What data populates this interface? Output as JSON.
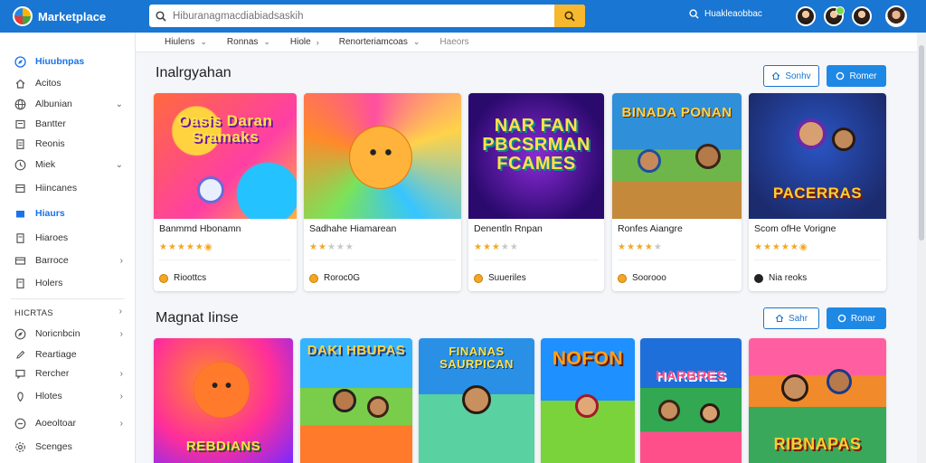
{
  "app": {
    "brand": "Marketplace",
    "logo_icon": "globe-logo-icon"
  },
  "search": {
    "placeholder": "Hiburanagmacdiabiadsaskih",
    "value": ""
  },
  "top_link": {
    "label": "Huakleaobbac",
    "icon": "search-icon"
  },
  "sidebar": {
    "items": [
      {
        "label": "Hiuubnpas",
        "icon": "compass-icon",
        "active": true
      },
      {
        "label": "Acitos",
        "icon": "home-icon"
      },
      {
        "label": "Albunian",
        "icon": "globe-icon",
        "chevron": "down"
      },
      {
        "label": "Bantter",
        "icon": "edit-icon"
      },
      {
        "label": "Reonis",
        "icon": "doc-icon"
      },
      {
        "label": "Miek",
        "icon": "clock-icon",
        "chevron": "down"
      },
      {
        "label": "Hiincanes",
        "icon": "list-icon"
      },
      {
        "label": "Hiaurs",
        "icon": "folder-icon",
        "active": true
      },
      {
        "label": "Hiaroes",
        "icon": "doc-icon"
      },
      {
        "label": "Barroce",
        "icon": "card-icon",
        "chevron": "right"
      },
      {
        "label": "Holers",
        "icon": "doc-icon"
      }
    ],
    "heading": "HICRTAS",
    "heading_chevron": "right",
    "sub_items": [
      {
        "label": "Noricnbcin",
        "icon": "compass-icon",
        "chevron": "right"
      },
      {
        "label": "Reartiage",
        "icon": "edit-icon"
      },
      {
        "label": "Rercher",
        "icon": "chat-icon",
        "chevron": "right"
      },
      {
        "label": "Hlotes",
        "icon": "pin-icon",
        "chevron": "right"
      },
      {
        "label": "Aoeoltoar",
        "icon": "clock-icon",
        "chevron": "right"
      },
      {
        "label": "Scenges",
        "icon": "gear-icon"
      }
    ]
  },
  "subnav": {
    "items": [
      {
        "label": "Hiulens",
        "chevron": "down"
      },
      {
        "label": "Ronnas",
        "chevron": "down"
      },
      {
        "label": "Hiole",
        "chevron": "right"
      },
      {
        "label": "Renorteriamcoas",
        "chevron": "down"
      },
      {
        "label": "Haeors",
        "muted": true
      }
    ]
  },
  "section1": {
    "title": "Inalrgyahan",
    "outline_button": "Sonhv",
    "solid_button": "Romer",
    "cards": [
      {
        "thumb_title": "Oasis Daran Sramaks",
        "name": "Banmmd Hbonamn",
        "rating": 5,
        "badge": true,
        "price": "Rioottcs",
        "colors": [
          "#ff6a3d",
          "#ffd23f",
          "#ff3fa4"
        ]
      },
      {
        "thumb_title": "",
        "name": "Sadhahe Hiamarean",
        "rating": 2,
        "badge": true,
        "price": "Roroc0G",
        "colors": [
          "#ff4fa0",
          "#ffd24a",
          "#36c5ff"
        ]
      },
      {
        "thumb_title": "NAR FAN PBCSRMAN FCAMES",
        "name": "Denentln Rnpan",
        "rating": 3,
        "badge": false,
        "price": "Suueriles",
        "colors": [
          "#5b1aa8",
          "#2b0a6e",
          "#8b2ad6"
        ]
      },
      {
        "thumb_title": "BINADA PONAN",
        "name": "Ronfes Aiangre",
        "rating": 4,
        "badge": false,
        "price": "Soorooo",
        "colors": [
          "#2f8fd8",
          "#6fb64a",
          "#e0a040"
        ]
      },
      {
        "thumb_title": "PACERRAS",
        "name": "Scom ofHe Vorigne",
        "rating": 5,
        "badge": true,
        "price": "Nia reoks",
        "colors": [
          "#1c2b6e",
          "#2a55c4",
          "#d04aa8"
        ]
      }
    ]
  },
  "section2": {
    "title": "Magnat Iinse",
    "outline_button": "Sahr",
    "solid_button": "Ronar",
    "cards": [
      {
        "thumb_title": "REBDIANS",
        "colors": [
          "#ff2e9a",
          "#ff8a2a",
          "#7a2aff"
        ]
      },
      {
        "thumb_title": "DAKI HBUPAS",
        "colors": [
          "#35b3ff",
          "#7acd4a",
          "#ff7a2a"
        ]
      },
      {
        "thumb_title": "FINANAS SAURPICAN",
        "colors": [
          "#2a90e6",
          "#5ad1a0",
          "#1f5fb0"
        ]
      },
      {
        "thumb_title": "NOFON",
        "colors": [
          "#1e90ff",
          "#ff9f1a",
          "#7ad33a"
        ]
      },
      {
        "thumb_title": "HARBRES",
        "colors": [
          "#32a852",
          "#1e6fd9",
          "#ff4f8b"
        ]
      },
      {
        "thumb_title": "RIBNAPAS",
        "colors": [
          "#f08a2a",
          "#3aa85a",
          "#ff5fa0"
        ]
      }
    ]
  },
  "colors": {
    "topbar": "#1976d2",
    "accent": "#1e88e5",
    "star": "#f5a623",
    "search_button": "#f5b82e"
  }
}
